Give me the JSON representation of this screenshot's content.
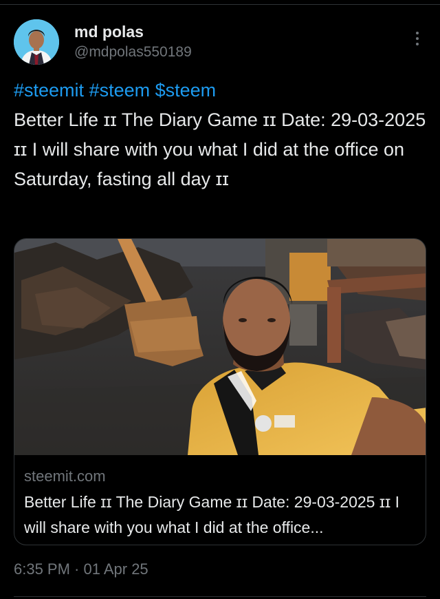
{
  "post": {
    "author": {
      "display_name": "md polas",
      "handle": "@mdpolas550189"
    },
    "hashtags": [
      "#steemit",
      "#steem",
      "$steem"
    ],
    "text": "Better Life ɪɪ The Diary Game ɪɪ Date: 29-03-2025 ɪɪ I will share with you what I did at the office on Saturday, fasting all day ɪɪ",
    "link_card": {
      "domain": "steemit.com",
      "title": "Better Life ɪɪ The Diary Game ɪɪ Date: 29-03-2025 ɪɪ I will share with you what I did at the office..."
    },
    "timestamp": "6:35 PM · 01 Apr 25"
  },
  "colors": {
    "background": "#000000",
    "text_primary": "#e7e9ea",
    "text_secondary": "#71767b",
    "link": "#1d9bf0",
    "border": "#2f3336"
  },
  "icons": {
    "more": "more-vertical-icon"
  }
}
